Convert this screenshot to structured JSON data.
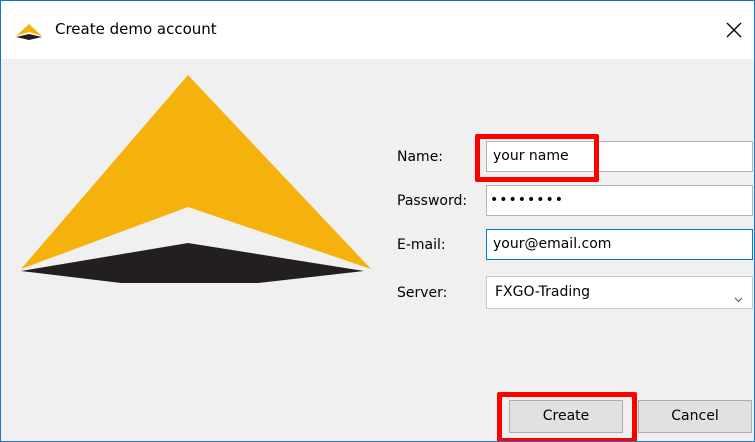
{
  "window": {
    "title": "Create demo account",
    "icons": {
      "app": "triangle-logo-icon",
      "close": "close-icon"
    }
  },
  "form": {
    "name_label": "Name:",
    "name_value": "your name",
    "password_label": "Password:",
    "password_masked": "••••••••",
    "email_label": "E-mail:",
    "email_value": "your@email.com",
    "server_label": "Server:",
    "server_value": "FXGO-Trading"
  },
  "buttons": {
    "create": "Create",
    "cancel": "Cancel"
  },
  "colors": {
    "logo_gold": "#f6b20c",
    "logo_dark": "#231f20",
    "highlight": "#ff0000",
    "focus_border": "#0078d7"
  }
}
